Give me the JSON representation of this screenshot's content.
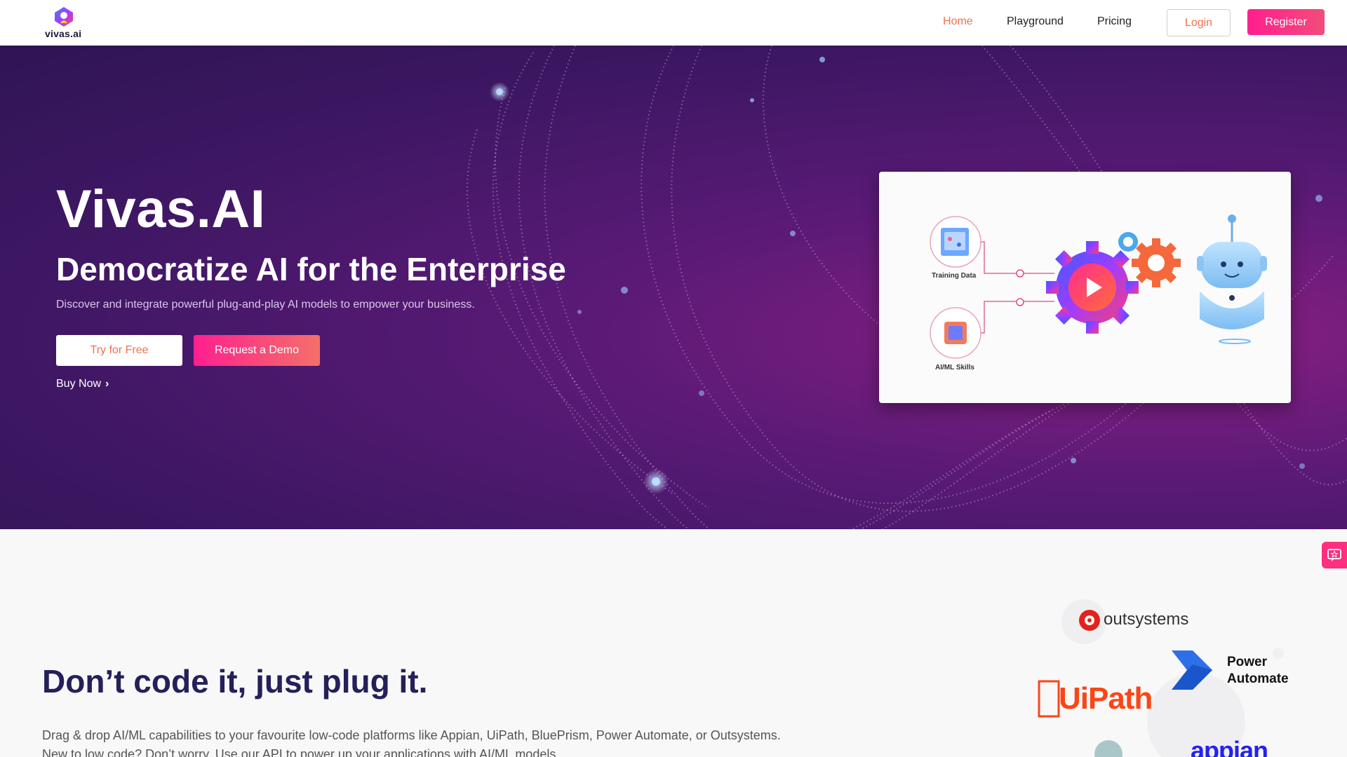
{
  "header": {
    "logo_text": "vivas.ai",
    "nav": {
      "home": "Home",
      "playground": "Playground",
      "pricing": "Pricing"
    },
    "login_label": "Login",
    "register_label": "Register"
  },
  "hero": {
    "title": "Vivas.AI",
    "subtitle": "Democratize AI for the Enterprise",
    "description": "Discover and integrate powerful plug-and-play AI models to empower your business.",
    "try_label": "Try for Free",
    "demo_label": "Request a Demo",
    "buy_label": "Buy Now",
    "video_card": {
      "training_label": "Training Data",
      "aiml_label": "AI/ML Skills"
    }
  },
  "section2": {
    "title": "Don’t code it, just plug it.",
    "line1": "Drag & drop AI/ML capabilities to your favourite low-code platforms like Appian, UiPath, BluePrism, Power Automate, or Outsystems.",
    "line2": "New to low code? Don’t worry. Use our API to power up your applications with AI/ML models."
  },
  "partners": {
    "outsystems": "outsystems",
    "power_automate_line1": "Power",
    "power_automate_line2": "Automate",
    "uipath": "UiPath",
    "appian": "appian"
  },
  "colors": {
    "accent": "#f0714f",
    "register": "#ff1f8e",
    "hero_bg": "#4a1870",
    "title_dark": "#24205a"
  },
  "icons": [
    "vivas-logo-icon",
    "chevron-right-icon",
    "play-icon",
    "feedback-icon",
    "outsystems-logo-icon",
    "power-automate-logo-icon"
  ]
}
